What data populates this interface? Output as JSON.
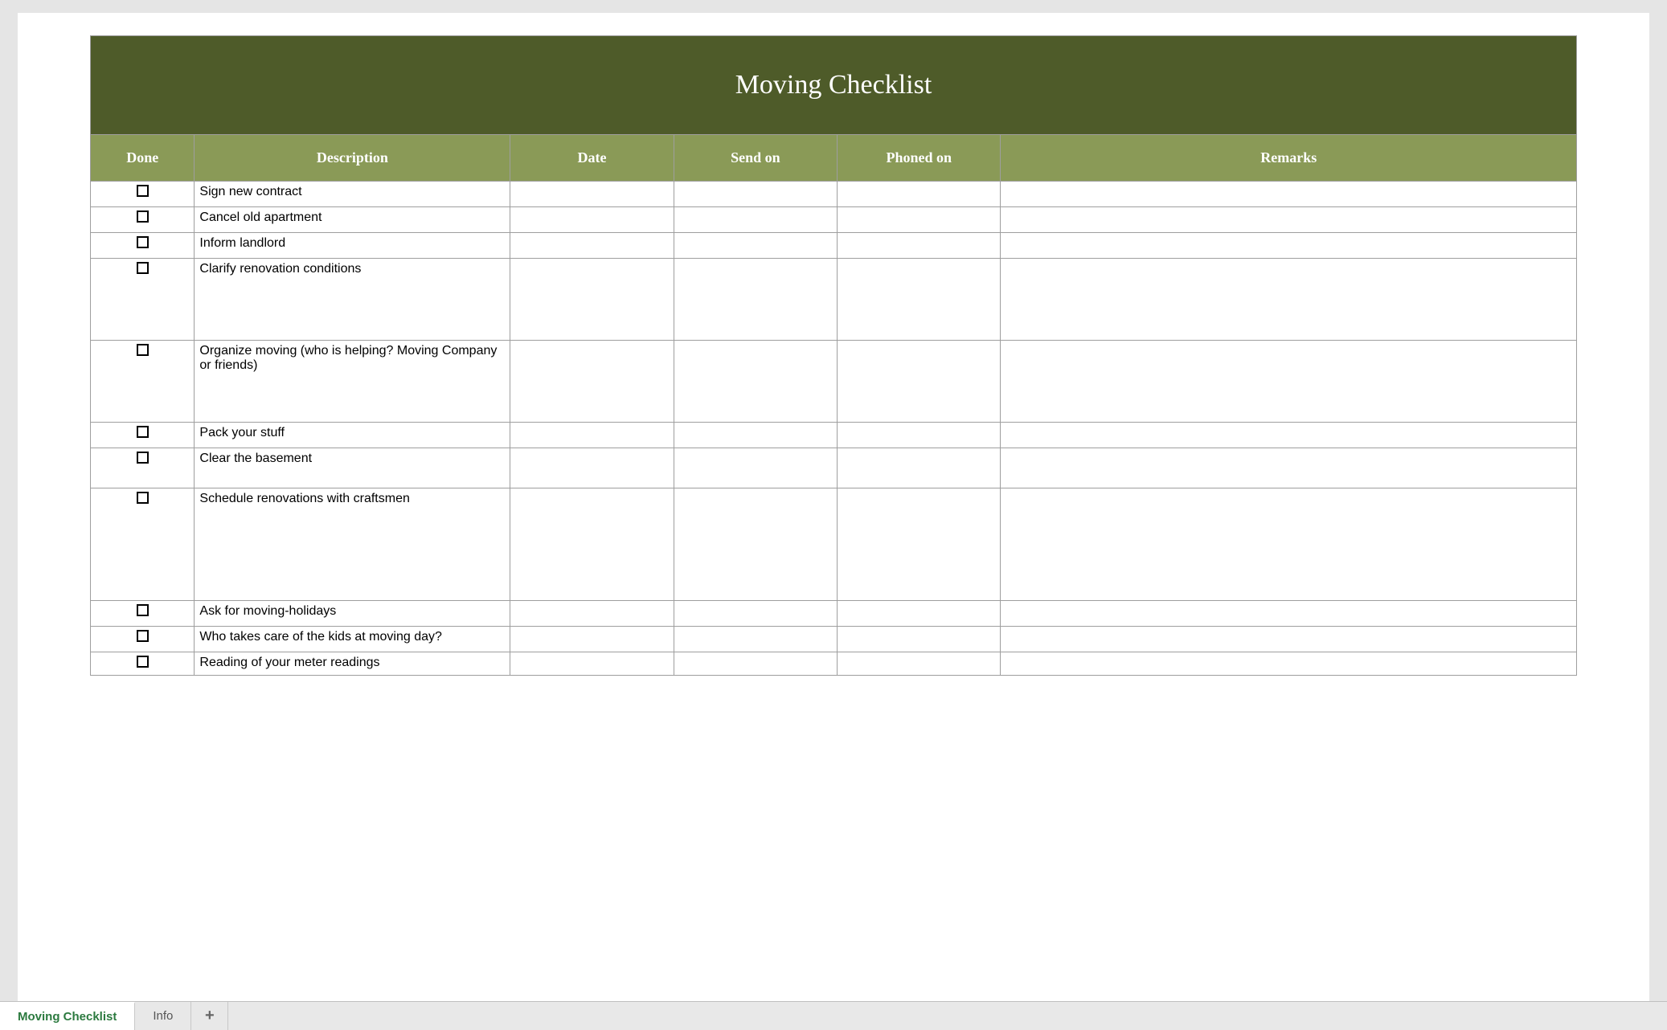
{
  "title": "Moving Checklist",
  "columns": {
    "done": "Done",
    "description": "Description",
    "date": "Date",
    "send_on": "Send on",
    "phoned_on": "Phoned on",
    "remarks": "Remarks"
  },
  "rows": [
    {
      "done": false,
      "description": "Sign new contract",
      "date": "",
      "send_on": "",
      "phoned_on": "",
      "remarks": "",
      "size": "small"
    },
    {
      "done": false,
      "description": "Cancel old apartment",
      "date": "",
      "send_on": "",
      "phoned_on": "",
      "remarks": "",
      "size": "small"
    },
    {
      "done": false,
      "description": "Inform landlord",
      "date": "",
      "send_on": "",
      "phoned_on": "",
      "remarks": "",
      "size": "small"
    },
    {
      "done": false,
      "description": "Clarify renovation conditions",
      "date": "",
      "send_on": "",
      "phoned_on": "",
      "remarks": "",
      "size": "tall"
    },
    {
      "done": false,
      "description": "Organize moving (who is helping? Moving Company or friends)",
      "date": "",
      "send_on": "",
      "phoned_on": "",
      "remarks": "",
      "size": "tall"
    },
    {
      "done": false,
      "description": "Pack your stuff",
      "date": "",
      "send_on": "",
      "phoned_on": "",
      "remarks": "",
      "size": "small"
    },
    {
      "done": false,
      "description": "Clear the basement",
      "date": "",
      "send_on": "",
      "phoned_on": "",
      "remarks": "",
      "size": "med"
    },
    {
      "done": false,
      "description": "Schedule renovations with craftsmen",
      "date": "",
      "send_on": "",
      "phoned_on": "",
      "remarks": "",
      "size": "xtall"
    },
    {
      "done": false,
      "description": "Ask for moving-holidays",
      "date": "",
      "send_on": "",
      "phoned_on": "",
      "remarks": "",
      "size": "small"
    },
    {
      "done": false,
      "description": "Who takes care of the kids at moving day?",
      "date": "",
      "send_on": "",
      "phoned_on": "",
      "remarks": "",
      "size": "small"
    },
    {
      "done": false,
      "description": "Reading of your meter readings",
      "date": "",
      "send_on": "",
      "phoned_on": "",
      "remarks": "",
      "size": "partial"
    }
  ],
  "tabs": {
    "active": "Moving Checklist",
    "others": [
      "Info"
    ],
    "add_label": "+"
  }
}
